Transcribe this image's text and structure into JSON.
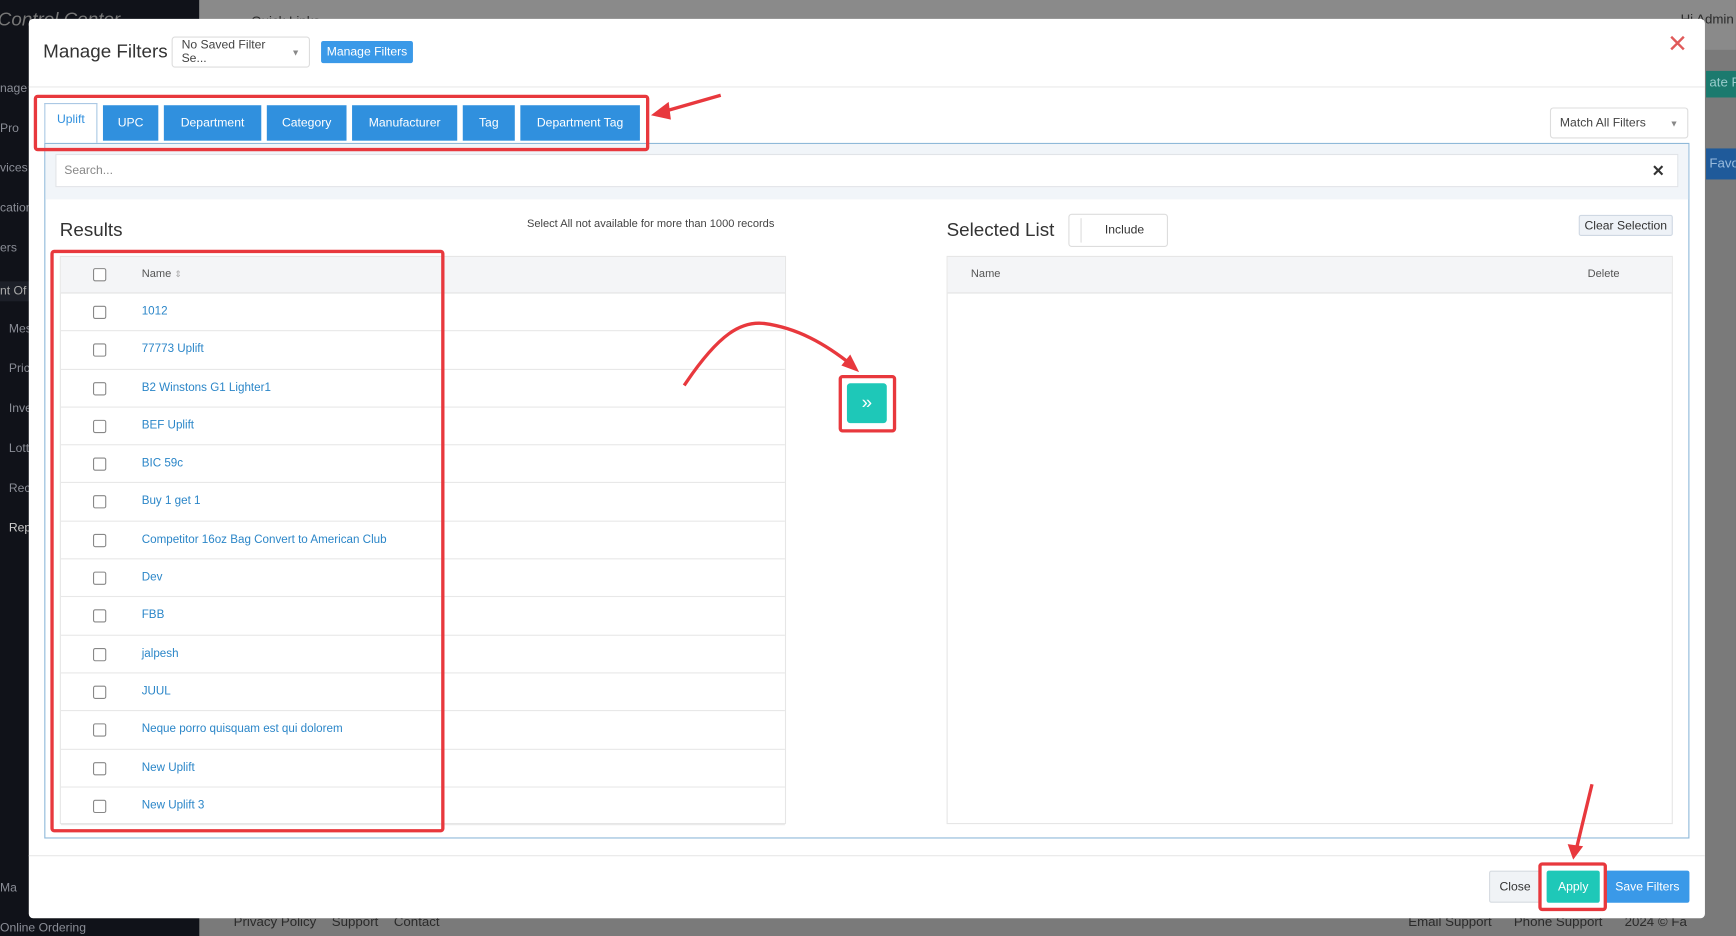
{
  "background": {
    "brand": "Control Center",
    "sidebar_items": [
      "nage",
      "Pro",
      "vices",
      "cation",
      "ers",
      "nt Of",
      "Mes",
      "Pric",
      "Inve",
      "Lott",
      "Rec",
      "Rep",
      "Ma",
      "Online Ordering"
    ],
    "topbar_quick_links": "Quick Links",
    "greeting": "Hi Admin",
    "right_buttons": [
      "ate Re",
      "Favori"
    ],
    "footer_links": [
      "Privacy Policy",
      "Support",
      "Contact"
    ],
    "footer_right": [
      "Email Support",
      "Phone Support",
      "2024 © Fa"
    ]
  },
  "modal": {
    "title": "Manage Filters",
    "saved_filter_select": "No Saved Filter Se...",
    "manage_filters_button": "Manage Filters",
    "tabs": [
      {
        "label": "Uplift",
        "active": true
      },
      {
        "label": "UPC"
      },
      {
        "label": "Department"
      },
      {
        "label": "Category"
      },
      {
        "label": "Manufacturer"
      },
      {
        "label": "Tag"
      },
      {
        "label": "Department Tag"
      }
    ],
    "match_select": "Match All Filters",
    "search_placeholder": "Search...",
    "results": {
      "heading": "Results",
      "note": "Select All not available for more than 1000 records",
      "column_name": "Name",
      "rows": [
        "1012",
        "77773 Uplift",
        "B2 Winstons G1 Lighter1",
        "BEF Uplift",
        "BIC 59c",
        "Buy 1 get 1",
        "Competitor 16oz Bag Convert to American Club",
        "Dev",
        "FBB",
        "jalpesh",
        "JUUL",
        "Neque porro quisquam est qui dolorem",
        "New Uplift",
        "New Uplift 3"
      ]
    },
    "selected": {
      "heading": "Selected List",
      "include_toggle": "Include",
      "clear_button": "Clear Selection",
      "column_name": "Name",
      "column_delete": "Delete"
    },
    "footer": {
      "close": "Close",
      "apply": "Apply",
      "save": "Save Filters"
    }
  },
  "colors": {
    "primary": "#3090de",
    "teal": "#1ec8b8",
    "annotation": "#e8383d",
    "close_x": "#e05a5a"
  }
}
